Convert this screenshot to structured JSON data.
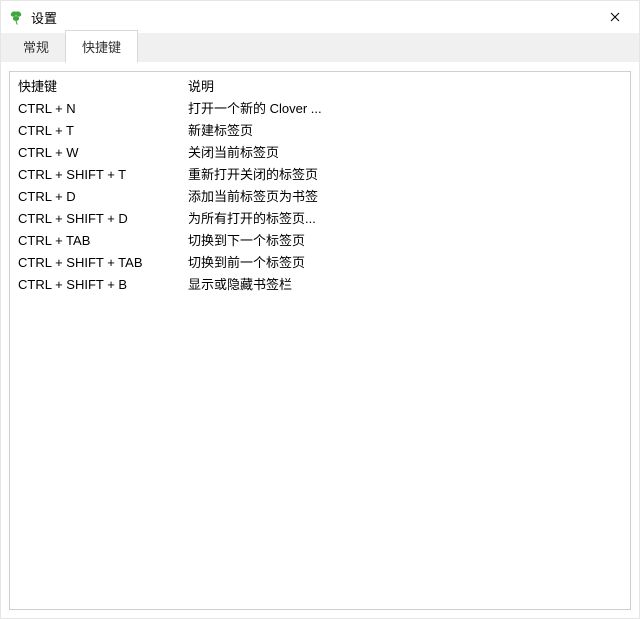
{
  "window": {
    "title": "设置"
  },
  "tabs": {
    "general": "常规",
    "shortcuts": "快捷键"
  },
  "table": {
    "header_key": "快捷键",
    "header_desc": "说明",
    "rows": [
      {
        "key": "CTRL + N",
        "desc": "打开一个新的 Clover ..."
      },
      {
        "key": "CTRL + T",
        "desc": "新建标签页"
      },
      {
        "key": "CTRL + W",
        "desc": "关闭当前标签页"
      },
      {
        "key": "CTRL + SHIFT + T",
        "desc": "重新打开关闭的标签页"
      },
      {
        "key": "CTRL + D",
        "desc": "添加当前标签页为书签"
      },
      {
        "key": "CTRL + SHIFT + D",
        "desc": "为所有打开的标签页..."
      },
      {
        "key": "CTRL + TAB",
        "desc": "切换到下一个标签页"
      },
      {
        "key": "CTRL + SHIFT + TAB",
        "desc": "切换到前一个标签页"
      },
      {
        "key": "CTRL + SHIFT + B",
        "desc": "显示或隐藏书签栏"
      }
    ]
  }
}
